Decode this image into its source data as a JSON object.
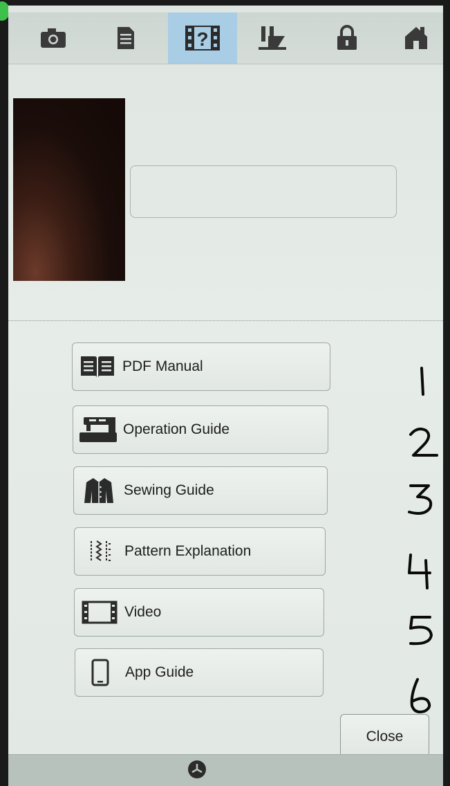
{
  "tabs": [
    {
      "icon": "camera-icon",
      "active": false
    },
    {
      "icon": "document-icon",
      "active": false
    },
    {
      "icon": "help-icon",
      "active": true
    },
    {
      "icon": "sewing-presser-foot-icon",
      "active": false
    },
    {
      "icon": "lock-icon",
      "active": false
    },
    {
      "icon": "home-icon",
      "active": false
    }
  ],
  "menu": [
    {
      "label": "PDF Manual",
      "icon": "book-icon"
    },
    {
      "label": "Operation Guide",
      "icon": "sewing-machine-icon"
    },
    {
      "label": "Sewing Guide",
      "icon": "jacket-icon"
    },
    {
      "label": "Pattern Explanation",
      "icon": "stitch-pattern-icon"
    },
    {
      "label": "Video",
      "icon": "film-icon"
    },
    {
      "label": "App Guide",
      "icon": "smartphone-icon"
    }
  ],
  "close_label": "Close",
  "handwritten_numbers": [
    "1",
    "2",
    "3",
    "4",
    "5",
    "6"
  ],
  "status_icon": "clock-icon",
  "colors": {
    "active_tab": "#a9cde4",
    "screen_bg": "#e2e8e4",
    "icon_dark": "#2b2b2b"
  }
}
